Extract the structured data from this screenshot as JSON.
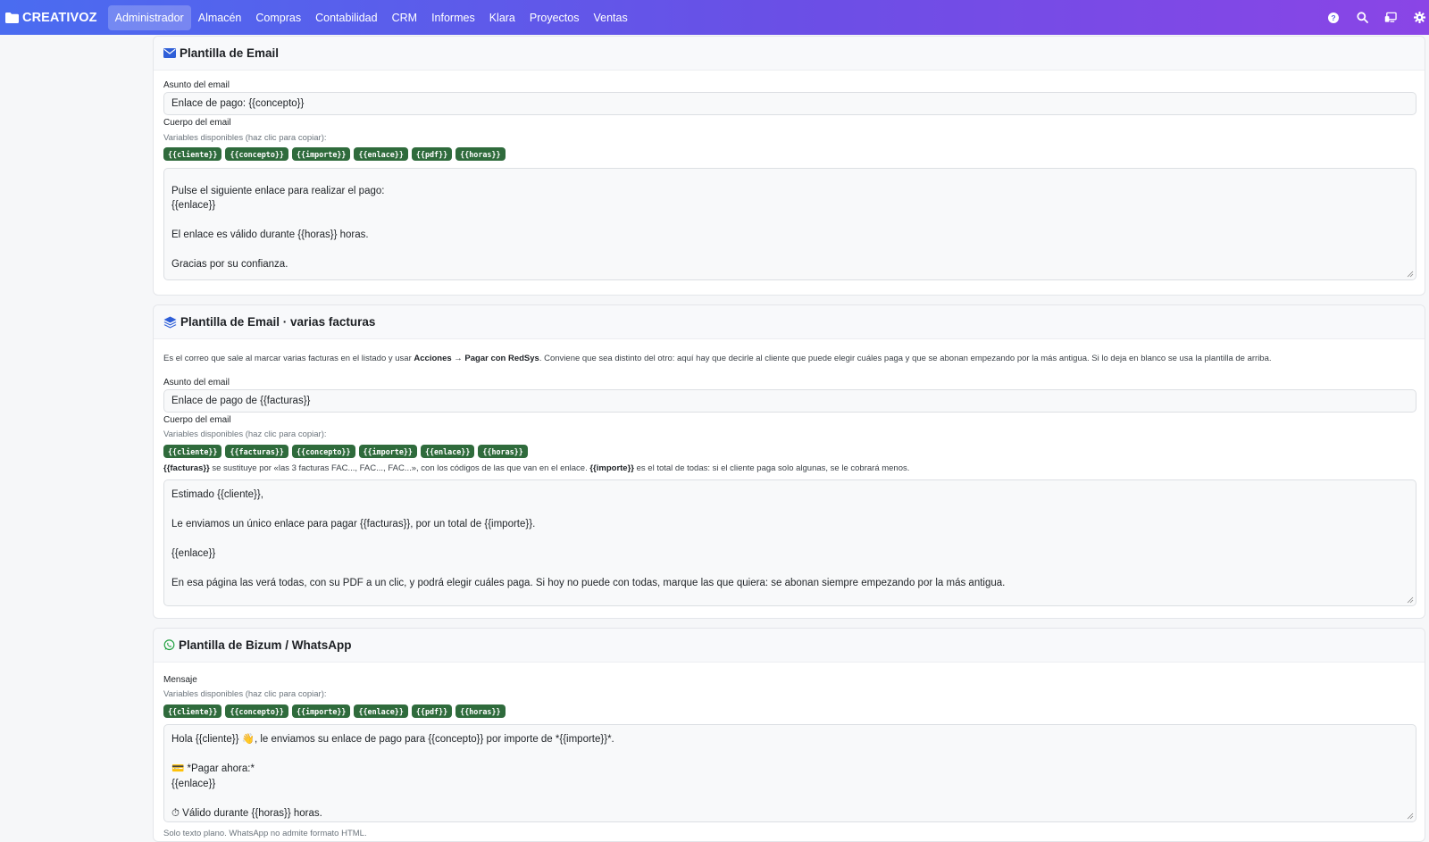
{
  "navbar": {
    "brand": "CREATIVOZ",
    "items": [
      "Administrador",
      "Almacén",
      "Compras",
      "Contabilidad",
      "CRM",
      "Informes",
      "Klara",
      "Proyectos",
      "Ventas"
    ],
    "active_index": 0,
    "icons": [
      "help-icon",
      "search-icon",
      "devices-icon",
      "gear-icon"
    ]
  },
  "email_template": {
    "title": "Plantilla de Email",
    "subject_label": "Asunto del email",
    "subject_value": "Enlace de pago: {{concepto}}",
    "body_label": "Cuerpo del email",
    "vars_label": "Variables disponibles (haz clic para copiar):",
    "vars": [
      "{{cliente}}",
      "{{concepto}}",
      "{{importe}}",
      "{{enlace}}",
      "{{pdf}}",
      "{{horas}}"
    ],
    "body_lines": [
      "",
      "Pulse el siguiente enlace para realizar el pago:",
      "{{enlace}}",
      "",
      "El enlace es válido durante {{horas}} horas.",
      "",
      "Gracias por su confianza."
    ]
  },
  "multi_template": {
    "title": "Plantilla de Email · varias facturas",
    "desc_1": "Es el correo que sale al marcar varias facturas en el listado y usar ",
    "desc_bold": "Acciones → Pagar con RedSys",
    "desc_2": ". Conviene que sea distinto del otro: aquí hay que decirle al cliente que puede elegir cuáles paga y que se abonan empezando por la más antigua. Si lo deja en blanco se usa la plantilla de arriba.",
    "subject_label": "Asunto del email",
    "subject_value": "Enlace de pago de {{facturas}}",
    "body_label": "Cuerpo del email",
    "vars_label": "Variables disponibles (haz clic para copiar):",
    "vars": [
      "{{cliente}}",
      "{{facturas}}",
      "{{concepto}}",
      "{{importe}}",
      "{{enlace}}",
      "{{horas}}"
    ],
    "note_b1": "{{facturas}}",
    "note_1": " se sustituye por «las 3 facturas FAC..., FAC..., FAC...», con los códigos de las que van en el enlace. ",
    "note_b2": "{{importe}}",
    "note_2": " es el total de todas: si el cliente paga solo algunas, se le cobrará menos.",
    "body_lines": [
      "Estimado {{cliente}},",
      "",
      "Le enviamos un único enlace para pagar {{facturas}}, por un total de {{importe}}.",
      "",
      "{{enlace}}",
      "",
      "En esa página las verá todas, con su PDF a un clic, y podrá elegir cuáles paga. Si hoy no puede con todas, marque las que quiera: se abonan siempre empezando por la más antigua."
    ]
  },
  "bizum_template": {
    "title": "Plantilla de Bizum / WhatsApp",
    "message_label": "Mensaje",
    "vars_label": "Variables disponibles (haz clic para copiar):",
    "vars": [
      "{{cliente}}",
      "{{concepto}}",
      "{{importe}}",
      "{{enlace}}",
      "{{pdf}}",
      "{{horas}}"
    ],
    "body_lines": [
      "Hola {{cliente}} 👋, le enviamos su enlace de pago para {{concepto}} por importe de *{{importe}}*.",
      "",
      "💳 *Pagar ahora:*",
      "{{enlace}}",
      "",
      "⏱ Válido durante {{horas}} horas."
    ],
    "footer": "Solo texto plano. WhatsApp no admite formato HTML."
  }
}
